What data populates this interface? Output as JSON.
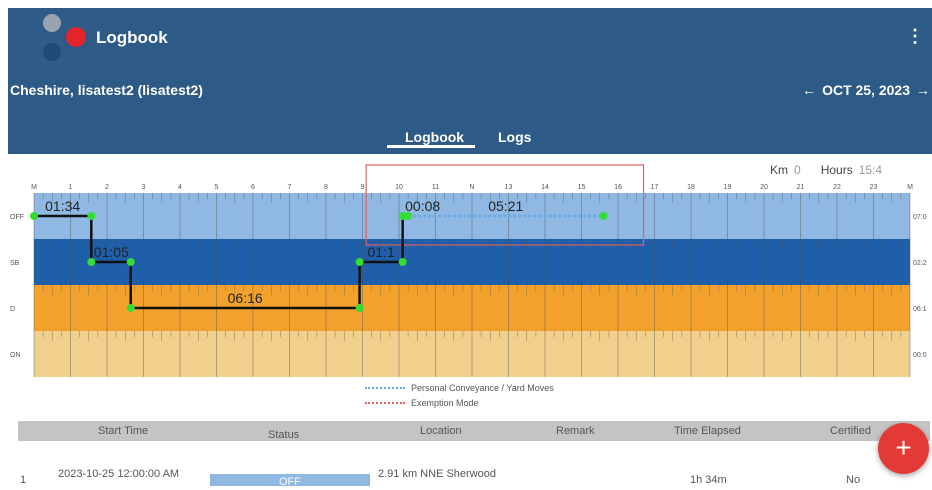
{
  "app": {
    "title": "Logbook",
    "menu_icon": "more-vert-icon"
  },
  "driver": {
    "name": "Cheshire, lisatest2 (lisatest2)"
  },
  "date_nav": {
    "prev_arrow": "←",
    "date": "OCT 25, 2023",
    "next_arrow": "→"
  },
  "tabs": [
    {
      "label": "Logbook",
      "active": true
    },
    {
      "label": "Logs",
      "active": false
    }
  ],
  "graph": {
    "km_label": "Km",
    "km_value": "0",
    "hours_label": "Hours",
    "hours_value": "15:4",
    "hour_labels": [
      "M",
      "1",
      "2",
      "3",
      "4",
      "5",
      "6",
      "7",
      "8",
      "9",
      "10",
      "11",
      "N",
      "13",
      "14",
      "15",
      "16",
      "17",
      "18",
      "19",
      "20",
      "21",
      "22",
      "23",
      "M"
    ],
    "rows": [
      {
        "label": "OFF",
        "total": "07:0",
        "color": "#8fb8e2"
      },
      {
        "label": "SB",
        "total": "02:2",
        "color": "#1f5faa"
      },
      {
        "label": "D",
        "total": "06:1",
        "color": "#f2a22c"
      },
      {
        "label": "ON",
        "total": "00:0",
        "color": "#f0d08c"
      }
    ],
    "segments": [
      {
        "status": "OFF",
        "start": 0.0,
        "end": 1.57,
        "duration": "01:34"
      },
      {
        "status": "SB",
        "start": 1.57,
        "end": 2.65,
        "duration": "01:05"
      },
      {
        "status": "D",
        "start": 2.65,
        "end": 8.92,
        "duration": "06:16"
      },
      {
        "status": "SB",
        "start": 8.92,
        "end": 10.1,
        "duration": "01:1"
      },
      {
        "status": "OFF",
        "start": 10.1,
        "end": 10.25,
        "duration": "00:08"
      }
    ],
    "pc_segment": {
      "start": 10.25,
      "end": 15.6,
      "duration": "05:21"
    },
    "exemption_box": {
      "start": 9.1,
      "end": 16.7
    }
  },
  "legend": [
    {
      "label": "Personal Conveyance / Yard Moves",
      "color": "#6aa7e0"
    },
    {
      "label": "Exemption Mode",
      "color": "#e06060"
    }
  ],
  "table": {
    "headers": [
      "Start Time",
      "Status",
      "Location",
      "Remark",
      "Time Elapsed",
      "Certified"
    ],
    "rows": [
      {
        "index": "1",
        "start_time": "2023-10-25 12:00:00 AM",
        "status": "OFF",
        "location": "2.91 km NNE Sherwood",
        "elapsed": "1h 34m",
        "certified": "No"
      }
    ]
  },
  "fab": {
    "label": "+"
  }
}
